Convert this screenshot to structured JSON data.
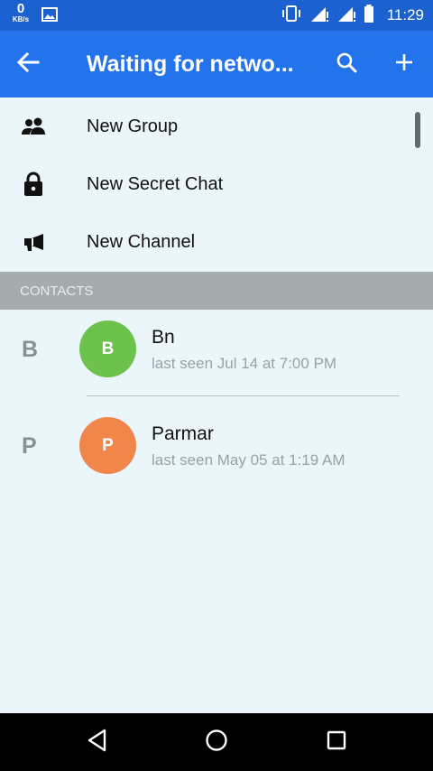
{
  "status_bar": {
    "speed_value": "0",
    "speed_unit": "KB/s",
    "time": "11:29",
    "icons": [
      "gallery-icon",
      "vibrate-icon",
      "signal-icon",
      "signal-icon",
      "battery-icon"
    ]
  },
  "app_bar": {
    "title": "Waiting for netwo...",
    "back_icon": "arrow-left-icon",
    "search_icon": "search-icon",
    "add_icon": "plus-icon"
  },
  "menu": {
    "items": [
      {
        "label": "New Group",
        "icon": "group-icon"
      },
      {
        "label": "New Secret Chat",
        "icon": "lock-icon"
      },
      {
        "label": "New Channel",
        "icon": "megaphone-icon"
      }
    ]
  },
  "contacts": {
    "section_label": "CONTACTS",
    "rows": [
      {
        "letter": "B",
        "initial": "B",
        "name": "Bn",
        "status": "last seen Jul 14 at 7:00 PM",
        "avatar_color": "#6cc24a"
      },
      {
        "letter": "P",
        "initial": "P",
        "name": "Parmar",
        "status": "last seen May 05 at 1:19 AM",
        "avatar_color": "#f0864a"
      }
    ]
  },
  "nav_bar": {
    "icons": [
      "back-triangle-icon",
      "home-circle-icon",
      "recents-square-icon"
    ]
  },
  "colors": {
    "status_bar": "#1b62d0",
    "app_bar": "#2273ec",
    "background": "#eaf6f9",
    "section_header": "#a5acae"
  }
}
